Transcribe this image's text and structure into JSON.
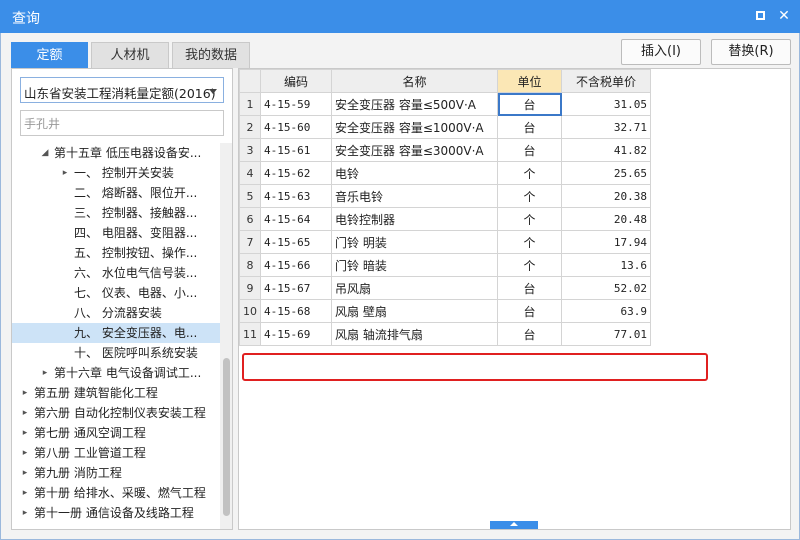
{
  "window": {
    "title": "查询"
  },
  "tabs": [
    {
      "label": "定额",
      "active": true
    },
    {
      "label": "人材机",
      "active": false
    },
    {
      "label": "我的数据",
      "active": false
    }
  ],
  "toolbar": {
    "insert_label": "插入(I)",
    "replace_label": "替换(R)"
  },
  "left": {
    "quota_select": "山东省安装工程消耗量定额(2016)",
    "search_value": "手孔井"
  },
  "tree": [
    {
      "label": "第十五章 低压电器设备安...",
      "level": 1,
      "toggle": "▲"
    },
    {
      "label": "一、 控制开关安装",
      "level": 2,
      "toggle": "▶"
    },
    {
      "label": "二、 熔断器、限位开...",
      "level": 2,
      "toggle": ""
    },
    {
      "label": "三、 控制器、接触器...",
      "level": 2,
      "toggle": ""
    },
    {
      "label": "四、 电阻器、变阻器...",
      "level": 2,
      "toggle": ""
    },
    {
      "label": "五、 控制按钮、操作...",
      "level": 2,
      "toggle": ""
    },
    {
      "label": "六、 水位电气信号装...",
      "level": 2,
      "toggle": ""
    },
    {
      "label": "七、 仪表、电器、小...",
      "level": 2,
      "toggle": ""
    },
    {
      "label": "八、 分流器安装",
      "level": 2,
      "toggle": ""
    },
    {
      "label": "九、 安全变压器、电...",
      "level": 2,
      "toggle": "",
      "selected": true
    },
    {
      "label": "十、 医院呼叫系统安装",
      "level": 2,
      "toggle": ""
    },
    {
      "label": "第十六章 电气设备调试工...",
      "level": 1,
      "toggle": "▶"
    },
    {
      "label": "第五册 建筑智能化工程",
      "level": 0,
      "toggle": "▶"
    },
    {
      "label": "第六册 自动化控制仪表安装工程",
      "level": 0,
      "toggle": "▶"
    },
    {
      "label": "第七册 通风空调工程",
      "level": 0,
      "toggle": "▶"
    },
    {
      "label": "第八册 工业管道工程",
      "level": 0,
      "toggle": "▶"
    },
    {
      "label": "第九册 消防工程",
      "level": 0,
      "toggle": "▶"
    },
    {
      "label": "第十册 给排水、采暖、燃气工程",
      "level": 0,
      "toggle": "▶"
    },
    {
      "label": "第十一册 通信设备及线路工程",
      "level": 0,
      "toggle": "▶"
    }
  ],
  "grid": {
    "columns": [
      "编码",
      "名称",
      "单位",
      "不含税单价"
    ],
    "rows": [
      {
        "num": "1",
        "code": "4-15-59",
        "name": "安全变压器 容量≤500V·A",
        "unit": "台",
        "price": "31.05"
      },
      {
        "num": "2",
        "code": "4-15-60",
        "name": "安全变压器 容量≤1000V·A",
        "unit": "台",
        "price": "32.71"
      },
      {
        "num": "3",
        "code": "4-15-61",
        "name": "安全变压器 容量≤3000V·A",
        "unit": "台",
        "price": "41.82"
      },
      {
        "num": "4",
        "code": "4-15-62",
        "name": "电铃",
        "unit": "个",
        "price": "25.65"
      },
      {
        "num": "5",
        "code": "4-15-63",
        "name": "音乐电铃",
        "unit": "个",
        "price": "20.38"
      },
      {
        "num": "6",
        "code": "4-15-64",
        "name": "电铃控制器",
        "unit": "个",
        "price": "20.48"
      },
      {
        "num": "7",
        "code": "4-15-65",
        "name": "门铃 明装",
        "unit": "个",
        "price": "17.94"
      },
      {
        "num": "8",
        "code": "4-15-66",
        "name": "门铃 暗装",
        "unit": "个",
        "price": "13.6"
      },
      {
        "num": "9",
        "code": "4-15-67",
        "name": "吊风扇",
        "unit": "台",
        "price": "52.02"
      },
      {
        "num": "10",
        "code": "4-15-68",
        "name": "风扇 壁扇",
        "unit": "台",
        "price": "63.9"
      },
      {
        "num": "11",
        "code": "4-15-69",
        "name": "风扇 轴流排气扇",
        "unit": "台",
        "price": "77.01"
      }
    ]
  },
  "colors": {
    "accent": "#3b8ee8",
    "highlight_header": "#fbe7b5",
    "selected_row": "#cde3f7",
    "annotation_red": "#e02020"
  }
}
